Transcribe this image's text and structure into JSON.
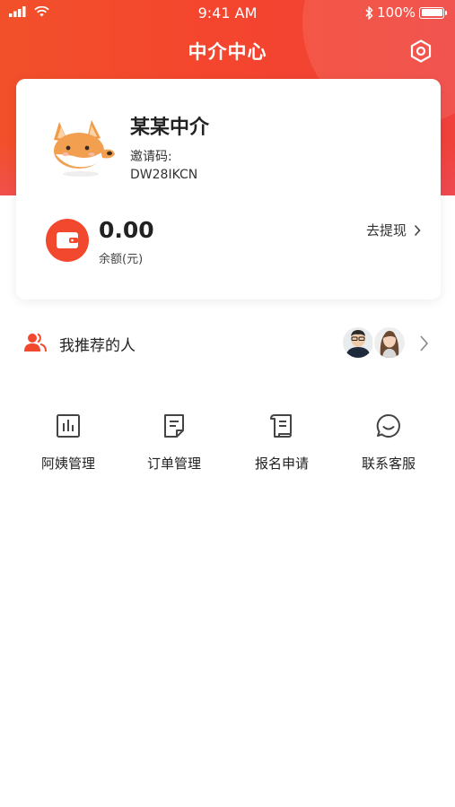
{
  "status_bar": {
    "time": "9:41 AM",
    "battery": "100%"
  },
  "header": {
    "title": "中介中心"
  },
  "profile": {
    "name": "某某中介",
    "invite_label": "邀请码:",
    "invite_code": "DW28IKCN"
  },
  "wallet": {
    "amount": "0.00",
    "label": "余额(元)",
    "withdraw_label": "去提现"
  },
  "recommend": {
    "label": "我推荐的人"
  },
  "menu": [
    {
      "label": "阿姨管理",
      "icon": "bar-chart-icon"
    },
    {
      "label": "订单管理",
      "icon": "document-icon"
    },
    {
      "label": "报名申请",
      "icon": "receipt-icon"
    },
    {
      "label": "联系客服",
      "icon": "chat-bubble-icon"
    }
  ],
  "colors": {
    "accent": "#f2482e",
    "icon_stroke": "#444444"
  }
}
